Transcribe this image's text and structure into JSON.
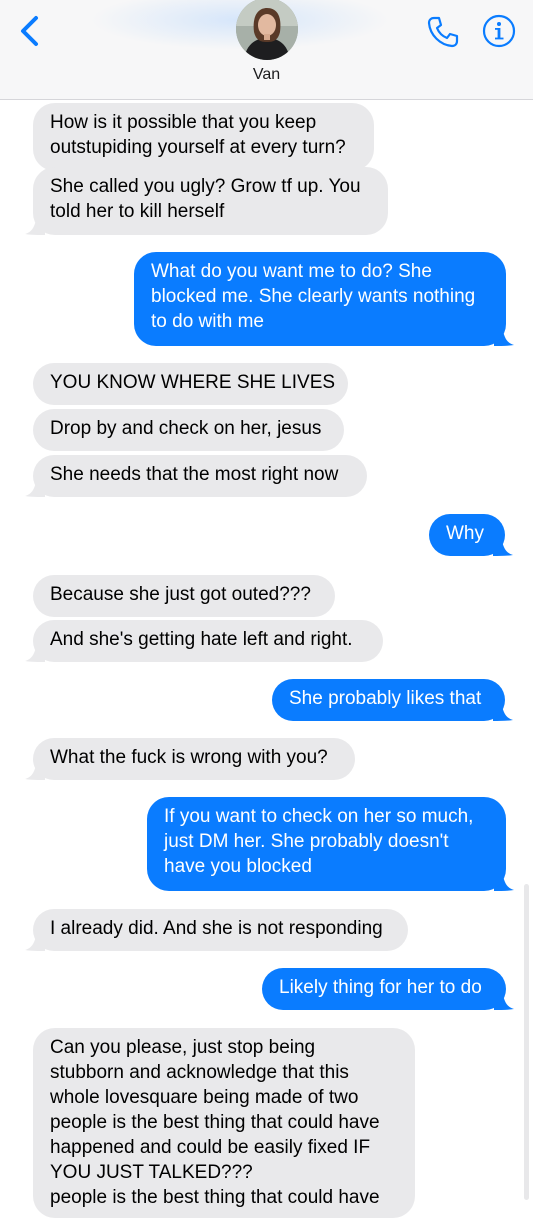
{
  "header": {
    "contact_name": "Van",
    "back_icon": "chevron-left-icon",
    "call_icon": "phone-icon",
    "info_icon": "info-icon",
    "accent_color": "#0a7cff"
  },
  "messages": [
    {
      "direction": "incoming",
      "lines": [
        "How is it possible that you keep",
        "outstupiding yourself at every turn?"
      ]
    },
    {
      "direction": "incoming",
      "lines": [
        "She called you ugly? Grow tf up. You",
        "told her to kill herself"
      ]
    },
    {
      "direction": "outgoing",
      "lines": [
        "What do you want me to do? She",
        "blocked me. She clearly wants nothing",
        "to do with me"
      ]
    },
    {
      "direction": "incoming",
      "lines": [
        "YOU KNOW WHERE SHE LIVES"
      ]
    },
    {
      "direction": "incoming",
      "lines": [
        "Drop by and check on her, jesus"
      ]
    },
    {
      "direction": "incoming",
      "lines": [
        "She needs that the most right now"
      ]
    },
    {
      "direction": "outgoing",
      "lines": [
        "Why"
      ]
    },
    {
      "direction": "incoming",
      "lines": [
        "Because she just got outed???"
      ]
    },
    {
      "direction": "incoming",
      "lines": [
        "And she's getting hate left and right."
      ]
    },
    {
      "direction": "outgoing",
      "lines": [
        "She probably likes that"
      ]
    },
    {
      "direction": "incoming",
      "lines": [
        "What the fuck is wrong with you?"
      ]
    },
    {
      "direction": "outgoing",
      "lines": [
        "If you want to check on her so much,",
        "just DM her. She probably doesn't",
        "have you blocked"
      ]
    },
    {
      "direction": "incoming",
      "lines": [
        "I already did. And she is not responding"
      ]
    },
    {
      "direction": "outgoing",
      "lines": [
        "Likely thing for her to do"
      ]
    },
    {
      "direction": "incoming",
      "lines": [
        "Can you please, just stop being",
        "stubborn and acknowledge that this",
        "whole lovesquare being made of two",
        "people is the best thing that could have",
        "happened and could be easily fixed IF",
        "YOU JUST TALKED???",
        "people is the best thing that could have"
      ]
    }
  ]
}
